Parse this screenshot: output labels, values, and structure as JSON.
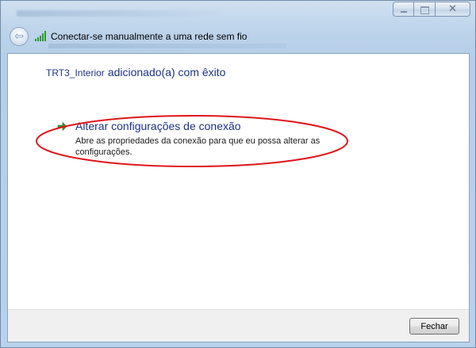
{
  "window": {
    "title": "Conectar-se manualmente a uma rede sem fio",
    "close_glyph": "✕"
  },
  "header": {
    "back_glyph": "⇦"
  },
  "content": {
    "network_name": "TRT3_Interior",
    "success_text": "adicionado(a) com êxito",
    "option": {
      "title": "Alterar configurações de conexão",
      "description": "Abre as propriedades da conexão para que eu possa alterar as configurações."
    },
    "highlight_color": "#e0141a"
  },
  "footer": {
    "close_label": "Fechar"
  },
  "colors": {
    "link_blue": "#1e3287",
    "arrow_green": "#2e9a2e"
  },
  "icons": [
    "back-arrow-icon",
    "wifi-signal-icon",
    "green-arrow-icon",
    "minimize-icon",
    "maximize-icon",
    "close-icon"
  ]
}
